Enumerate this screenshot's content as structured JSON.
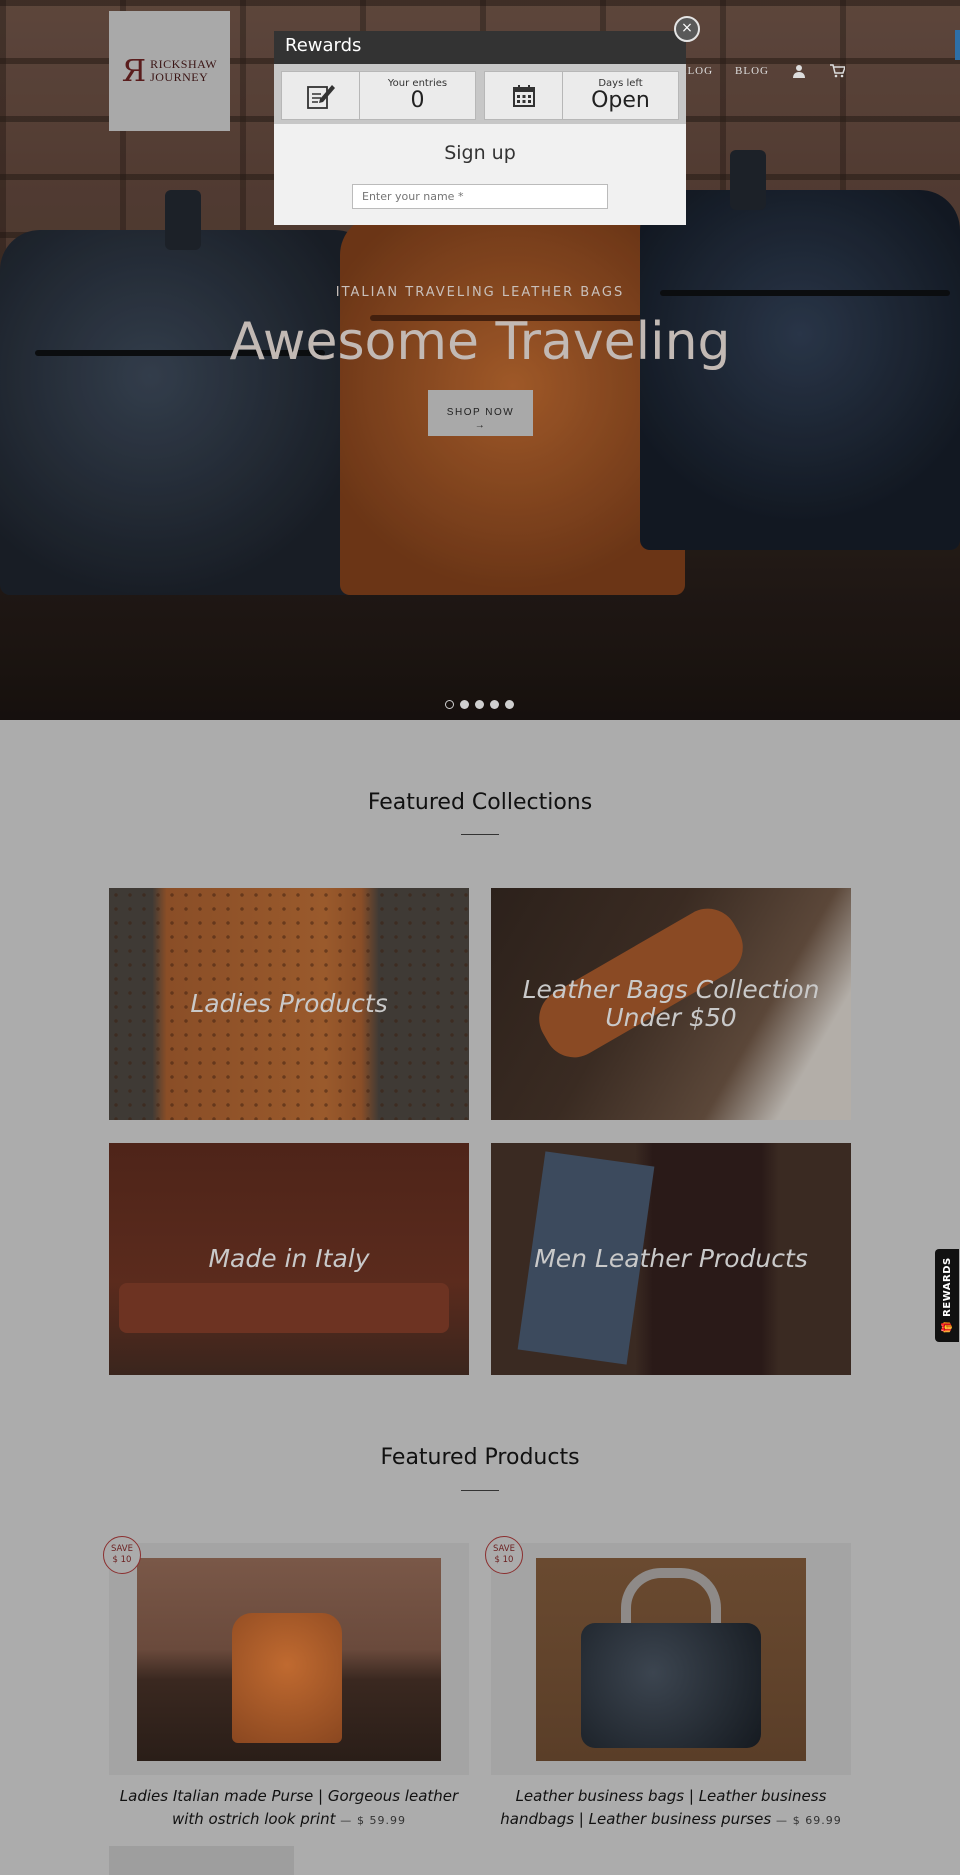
{
  "logo": {
    "text_line1": "RICKSHAW",
    "text_line2": "JOURNEY"
  },
  "nav": {
    "items": [
      "TALOG",
      "BLOG"
    ],
    "account_icon": "user-icon",
    "cart_icon": "cart-icon"
  },
  "hero": {
    "subtitle": "ITALIAN TRAVELING LEATHER BAGS",
    "title": "Awesome Traveling",
    "button_label": "SHOP NOW",
    "button_arrow": "→",
    "slides": 5,
    "active_slide": 1
  },
  "rewards_popup": {
    "title": "Rewards",
    "entries_label": "Your entries",
    "entries_value": "0",
    "days_label": "Days left",
    "days_value": "Open",
    "signup_title": "Sign up",
    "name_placeholder": "Enter your name *",
    "close_symbol": "×"
  },
  "featured_collections": {
    "title": "Featured Collections",
    "items": [
      {
        "label": "Ladies Products"
      },
      {
        "label": "Leather Bags Collection Under $50"
      },
      {
        "label": "Made in Italy"
      },
      {
        "label": "Men Leather Products"
      }
    ]
  },
  "featured_products": {
    "title": "Featured Products",
    "items": [
      {
        "badge_line1": "SAVE",
        "badge_line2": "$ 10",
        "name": "Ladies Italian made Purse | Gorgeous leather with ostrich look print",
        "separator": "—",
        "price": "$ 59.99"
      },
      {
        "badge_line1": "SAVE",
        "badge_line2": "$ 10",
        "name": "Leather business bags | Leather business handbags | Leather business purses",
        "separator": "—",
        "price": "$ 69.99"
      }
    ]
  },
  "rewards_tab": {
    "label": "REWARDS",
    "icon": "gift-icon"
  },
  "colors": {
    "popup_header": "#333333",
    "save_badge": "#8b2f2f",
    "page_bg": "#acacac"
  }
}
